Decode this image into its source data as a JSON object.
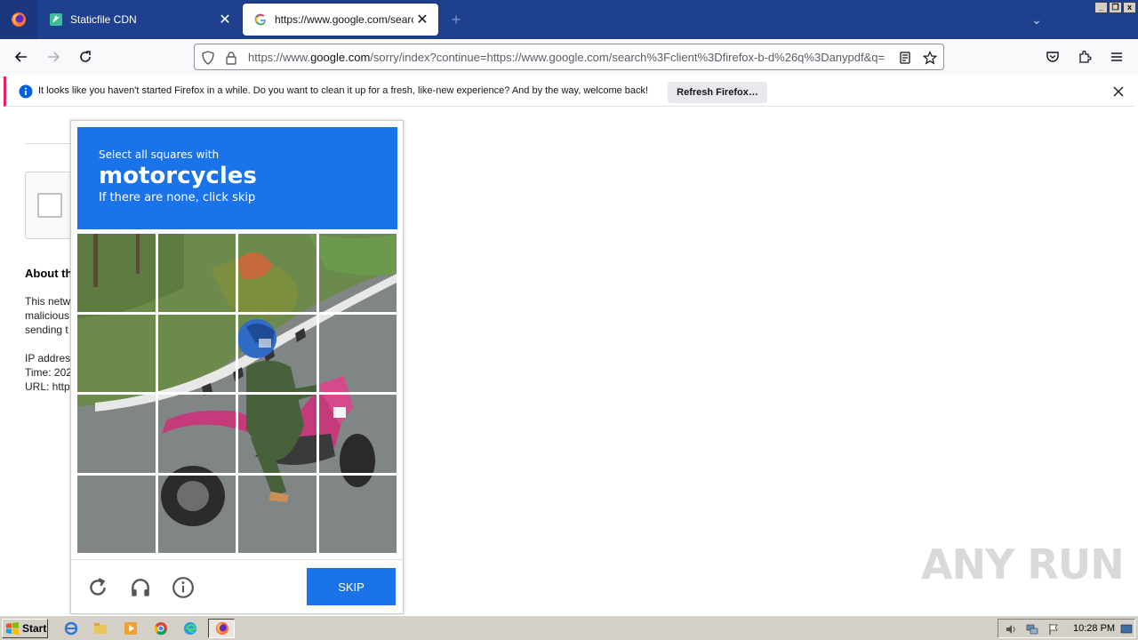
{
  "browser": {
    "tabs": [
      {
        "title": "Staticfile CDN",
        "favicon": "staticfile-icon",
        "active": false
      },
      {
        "title": "https://www.google.com/search?c",
        "favicon": "google-icon",
        "active": true
      }
    ],
    "url": {
      "prefix": "https://www.",
      "host": "google.com",
      "rest": "/sorry/index?continue=https://www.google.com/search%3Fclient%3Dfirefox-b-d%26q%3Danypdf&q="
    },
    "notification": {
      "text": "It looks like you haven't started Firefox in a while. Do you want to clean it up for a fresh, like-new experience? And by the way, welcome back!",
      "button": "Refresh Firefox…"
    },
    "window_controls": [
      "_",
      "❐",
      "x"
    ]
  },
  "page": {
    "about_heading": "About th",
    "lines": [
      "This netw",
      "malicious",
      "sending t",
      "IP addres",
      "Time: 202",
      "URL: http"
    ]
  },
  "captcha": {
    "instruction": "Select all squares with",
    "target": "motorcycles",
    "hint": "If there are none, click skip",
    "grid_size": 4,
    "skip_label": "SKIP",
    "header_color": "#1a73e8",
    "footer_icons": [
      "reload-icon",
      "headphones-icon",
      "info-icon"
    ]
  },
  "watermark": "ANY RUN",
  "taskbar": {
    "start_label": "Start",
    "apps": [
      "ie-icon",
      "explorer-icon",
      "media-player-icon",
      "chrome-icon",
      "edge-icon",
      "firefox-icon"
    ],
    "clock": "10:28 PM"
  }
}
